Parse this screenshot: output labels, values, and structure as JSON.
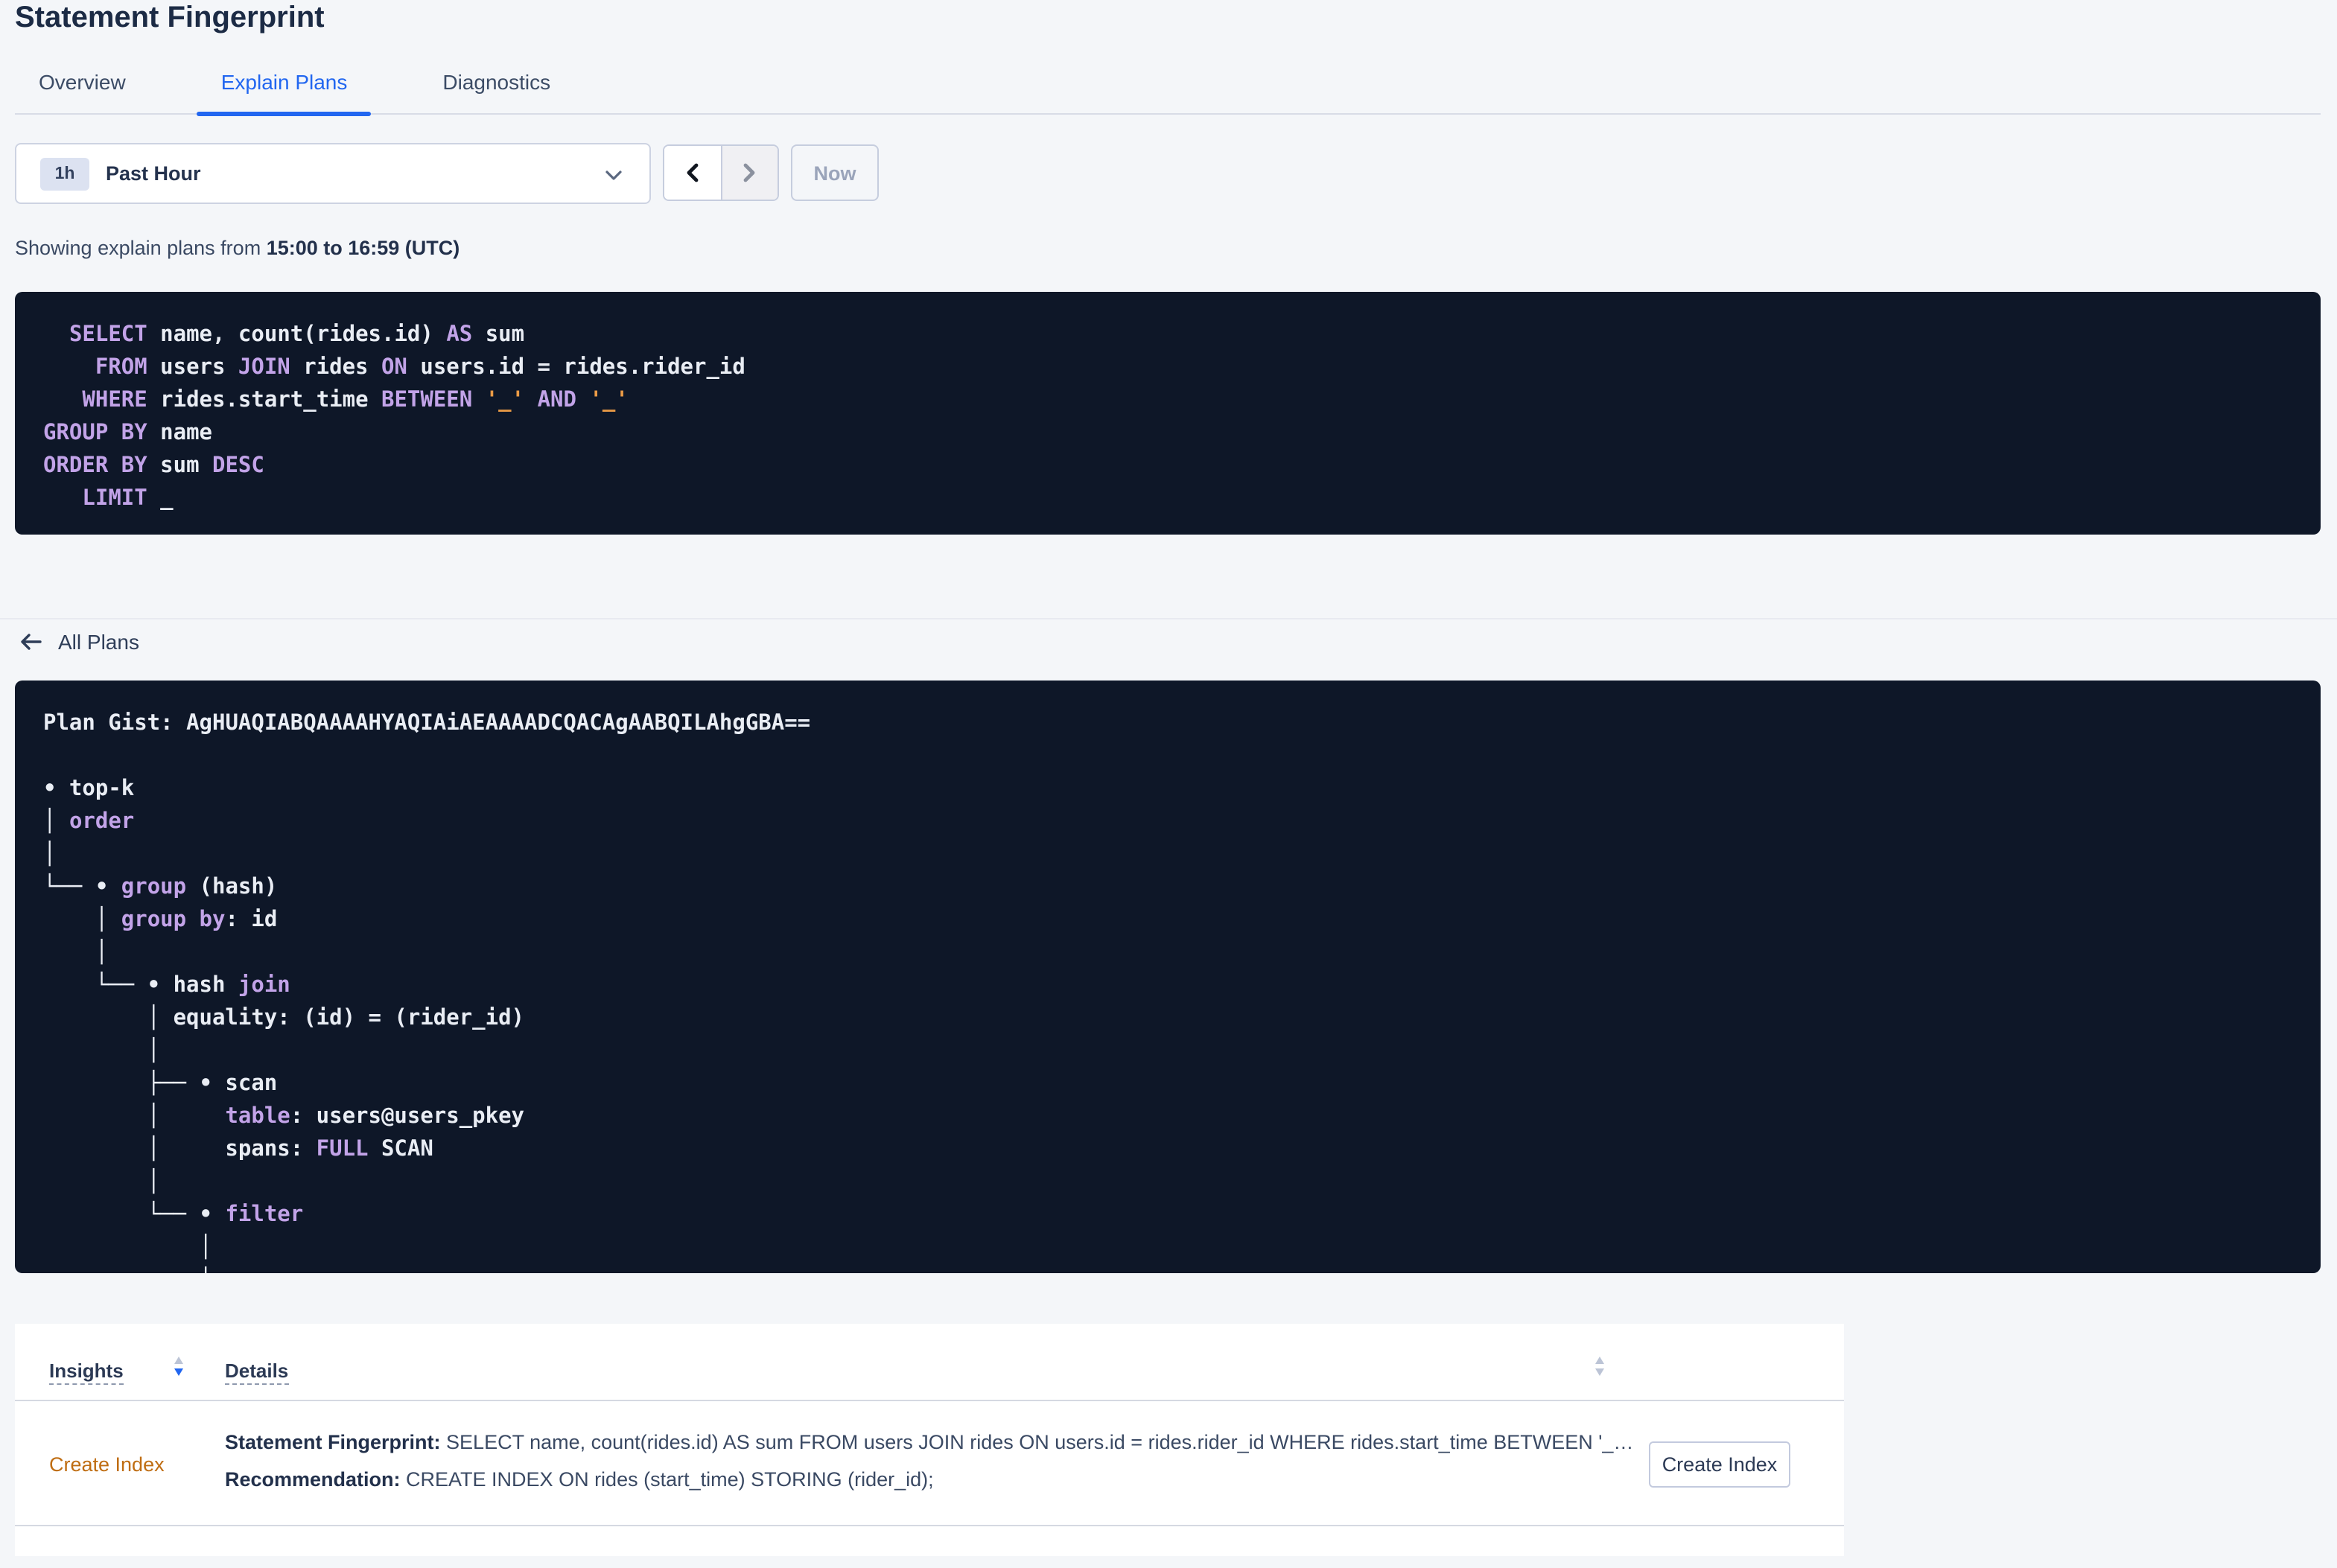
{
  "page": {
    "title": "Statement Fingerprint"
  },
  "tabs": [
    {
      "label": "Overview",
      "active": false
    },
    {
      "label": "Explain Plans",
      "active": true
    },
    {
      "label": "Diagnostics",
      "active": false
    }
  ],
  "time_picker": {
    "badge": "1h",
    "label": "Past Hour",
    "now_label": "Now"
  },
  "status_line": {
    "prefix": "Showing explain plans from ",
    "range": "15:00 to 16:59 (UTC)"
  },
  "sql_panel": {
    "lines": [
      [
        {
          "t": "id",
          "s": "  "
        },
        {
          "t": "kw",
          "s": "SELECT"
        },
        {
          "t": "id",
          "s": " name, count(rides.id) "
        },
        {
          "t": "kw",
          "s": "AS"
        },
        {
          "t": "id",
          "s": " sum"
        }
      ],
      [
        {
          "t": "id",
          "s": "    "
        },
        {
          "t": "kw",
          "s": "FROM"
        },
        {
          "t": "id",
          "s": " users "
        },
        {
          "t": "kw",
          "s": "JOIN"
        },
        {
          "t": "id",
          "s": " rides "
        },
        {
          "t": "kw",
          "s": "ON"
        },
        {
          "t": "id",
          "s": " users.id = rides.rider_id"
        }
      ],
      [
        {
          "t": "id",
          "s": "   "
        },
        {
          "t": "kw",
          "s": "WHERE"
        },
        {
          "t": "id",
          "s": " rides.start_time "
        },
        {
          "t": "kw",
          "s": "BETWEEN"
        },
        {
          "t": "id",
          "s": " "
        },
        {
          "t": "lit",
          "s": "'_'"
        },
        {
          "t": "id",
          "s": " "
        },
        {
          "t": "kw",
          "s": "AND"
        },
        {
          "t": "id",
          "s": " "
        },
        {
          "t": "lit",
          "s": "'_'"
        }
      ],
      [
        {
          "t": "kw",
          "s": "GROUP BY"
        },
        {
          "t": "id",
          "s": " name"
        }
      ],
      [
        {
          "t": "kw",
          "s": "ORDER BY"
        },
        {
          "t": "id",
          "s": " sum "
        },
        {
          "t": "kw",
          "s": "DESC"
        }
      ],
      [
        {
          "t": "id",
          "s": "   "
        },
        {
          "t": "kw",
          "s": "LIMIT"
        },
        {
          "t": "id",
          "s": " _"
        }
      ]
    ]
  },
  "all_plans_link": {
    "label": "All Plans"
  },
  "plan_panel": {
    "gist_label": "Plan Gist: ",
    "gist": "AgHUAQIABQAAAAHYAQIAiAEAAAADCQACAgAABQILAhgGBA==",
    "tree_lines": [
      [],
      [
        {
          "t": "id",
          "s": "• top-k"
        }
      ],
      [
        {
          "t": "id",
          "s": "│ "
        },
        {
          "t": "kw",
          "s": "order"
        }
      ],
      [
        {
          "t": "id",
          "s": "│"
        }
      ],
      [
        {
          "t": "id",
          "s": "└── • "
        },
        {
          "t": "kw",
          "s": "group"
        },
        {
          "t": "id",
          "s": " (hash)"
        }
      ],
      [
        {
          "t": "id",
          "s": "    │ "
        },
        {
          "t": "kw",
          "s": "group by"
        },
        {
          "t": "id",
          "s": ": id"
        }
      ],
      [
        {
          "t": "id",
          "s": "    │"
        }
      ],
      [
        {
          "t": "id",
          "s": "    └── • hash "
        },
        {
          "t": "kw",
          "s": "join"
        }
      ],
      [
        {
          "t": "id",
          "s": "        │ equality: (id) = (rider_id)"
        }
      ],
      [
        {
          "t": "id",
          "s": "        │"
        }
      ],
      [
        {
          "t": "id",
          "s": "        ├── • scan"
        }
      ],
      [
        {
          "t": "id",
          "s": "        │     "
        },
        {
          "t": "kw",
          "s": "table"
        },
        {
          "t": "id",
          "s": ": users@users_pkey"
        }
      ],
      [
        {
          "t": "id",
          "s": "        │     spans: "
        },
        {
          "t": "kw",
          "s": "FULL"
        },
        {
          "t": "id",
          "s": " SCAN"
        }
      ],
      [
        {
          "t": "id",
          "s": "        │"
        }
      ],
      [
        {
          "t": "id",
          "s": "        └── • "
        },
        {
          "t": "kw",
          "s": "filter"
        }
      ],
      [
        {
          "t": "id",
          "s": "            │"
        }
      ],
      [
        {
          "t": "id",
          "s": "            │"
        }
      ]
    ]
  },
  "insights_table": {
    "columns": [
      {
        "label": "Insights"
      },
      {
        "label": "Details"
      }
    ],
    "rows": [
      {
        "insight": "Create Index",
        "fingerprint_label": "Statement Fingerprint:",
        "fingerprint_text": " SELECT name, count(rides.id) AS sum FROM users JOIN rides ON users.id = rides.rider_id WHERE rides.start_time BETWEEN '_…",
        "recommendation_label": "Recommendation:",
        "recommendation_text": " CREATE INDEX ON rides (start_time) STORING (rider_id);",
        "action_label": "Create Index"
      }
    ]
  },
  "icons": {
    "time_range_chevron": "chevron-down",
    "prev_button": "chevron-left",
    "next_button": "chevron-right",
    "all_plans": "arrow-left",
    "column_sort": "sort-arrows"
  },
  "colors": {
    "page_bg": "#f4f6f9",
    "accent_blue": "#2166f0",
    "panel_bg": "#0e1728",
    "keyword_purple": "#c2a3e8",
    "literal_orange": "#eb9b46",
    "insight_link_orange": "#bf6d12"
  }
}
